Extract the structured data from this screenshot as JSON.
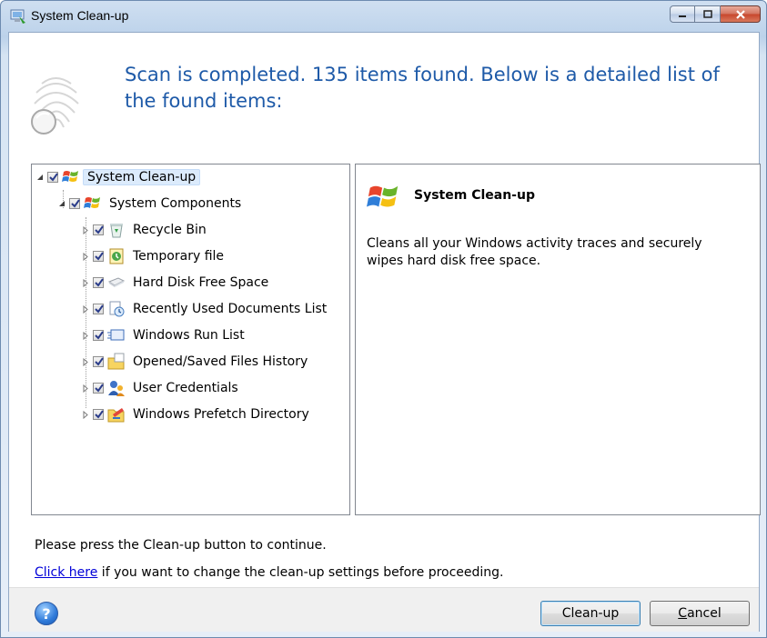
{
  "window": {
    "title": "System Clean-up"
  },
  "header": {
    "message": "Scan is completed. 135 items found. Below is a detailed list of the found items:"
  },
  "tree": {
    "root": {
      "label": "System Clean-up",
      "checked": true
    },
    "group": {
      "label": "System Components",
      "checked": true
    },
    "items": [
      {
        "label": "Recycle Bin",
        "icon": "recycle-bin-icon",
        "checked": true
      },
      {
        "label": "Temporary file",
        "icon": "temporary-file-icon",
        "checked": true
      },
      {
        "label": "Hard Disk Free Space",
        "icon": "hard-disk-icon",
        "checked": true
      },
      {
        "label": "Recently Used Documents List",
        "icon": "recent-documents-icon",
        "checked": true
      },
      {
        "label": "Windows Run List",
        "icon": "run-list-icon",
        "checked": true
      },
      {
        "label": "Opened/Saved Files History",
        "icon": "folder-history-icon",
        "checked": true
      },
      {
        "label": "User Credentials",
        "icon": "user-credentials-icon",
        "checked": true
      },
      {
        "label": "Windows Prefetch Directory",
        "icon": "prefetch-directory-icon",
        "checked": true
      }
    ]
  },
  "detail": {
    "title": "System Clean-up",
    "description": "Cleans all your Windows activity traces and securely wipes hard disk free space."
  },
  "notes": {
    "line1": "Please press the Clean-up button to continue.",
    "link_text": "Click here",
    "line2_rest": " if you want to change the clean-up settings before proceeding."
  },
  "buttons": {
    "cleanup": "Clean-up",
    "cancel_prefix": "",
    "cancel_underlined": "C",
    "cancel_rest": "ancel"
  }
}
